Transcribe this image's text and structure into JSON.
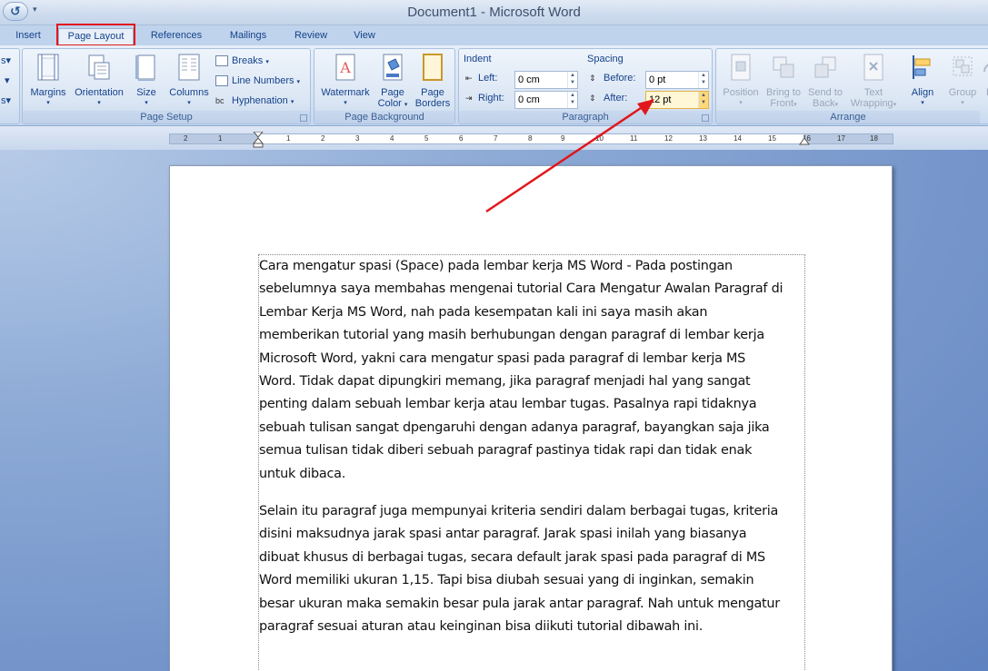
{
  "window": {
    "title": "Document1 - Microsoft Word"
  },
  "tabs": [
    {
      "label": "Insert"
    },
    {
      "label": "Page Layout"
    },
    {
      "label": "References"
    },
    {
      "label": "Mailings"
    },
    {
      "label": "Review"
    },
    {
      "label": "View"
    }
  ],
  "ribbon": {
    "page_setup": {
      "label": "Page Setup",
      "margins": "Margins",
      "orientation": "Orientation",
      "size": "Size",
      "columns": "Columns",
      "breaks": "Breaks",
      "line_numbers": "Line Numbers",
      "hyphenation": "Hyphenation"
    },
    "page_background": {
      "label": "Page Background",
      "watermark": "Watermark",
      "page_color_1": "Page",
      "page_color_2": "Color",
      "page_borders_1": "Page",
      "page_borders_2": "Borders"
    },
    "paragraph": {
      "label": "Paragraph",
      "indent_heading": "Indent",
      "left_label": "Left:",
      "left_value": "0 cm",
      "right_label": "Right:",
      "right_value": "0 cm",
      "spacing_heading": "Spacing",
      "before_label": "Before:",
      "before_value": "0 pt",
      "after_label": "After:",
      "after_value": "12 pt"
    },
    "arrange": {
      "label": "Arrange",
      "position": "Position",
      "bring_to_front_1": "Bring to",
      "bring_to_front_2": "Front",
      "send_to_back_1": "Send to",
      "send_to_back_2": "Back",
      "text_wrapping_1": "Text",
      "text_wrapping_2": "Wrapping",
      "align": "Align",
      "group": "Group",
      "rotate": "R"
    }
  },
  "ruler": {
    "ticks": [
      "2",
      "1",
      "1",
      "2",
      "3",
      "4",
      "5",
      "6",
      "7",
      "8",
      "9",
      "10",
      "11",
      "12",
      "13",
      "14",
      "15",
      "16",
      "17",
      "18"
    ]
  },
  "document": {
    "paragraphs": [
      [
        "Cara mengatur spasi (Space) pada lembar kerja MS Word - Pada postingan",
        "sebelumnya saya membahas mengenai tutorial Cara Mengatur Awalan Paragraf di",
        "Lembar Kerja MS Word, nah pada kesempatan kali ini saya masih akan",
        "memberikan tutorial yang masih berhubungan dengan paragraf di lembar kerja",
        "Microsoft Word, yakni  cara mengatur spasi pada paragraf di lembar kerja MS",
        "Word. Tidak dapat dipungkiri  memang, jika paragraf menjadi hal yang sangat",
        "penting dalam sebuah lembar kerja atau lembar tugas. Pasalnya rapi tidaknya",
        "sebuah tulisan sangat dpengaruhi dengan adanya paragraf, bayangkan saja jika",
        "semua tulisan tidak diberi sebuah paragraf pastinya tidak rapi dan tidak enak",
        "untuk dibaca."
      ],
      [
        "Selain itu paragraf juga mempunyai kriteria sendiri dalam berbagai tugas, kriteria",
        "disini maksudnya jarak spasi antar paragraf. Jarak spasi inilah yang biasanya",
        "dibuat khusus di berbagai tugas, secara default jarak spasi pada paragraf di MS",
        "Word memiliki ukuran 1,15. Tapi bisa diubah sesuai yang di inginkan, semakin",
        "besar ukuran maka semakin besar pula jarak antar paragraf. Nah untuk mengatur",
        "paragraf sesuai aturan atau keinginan bisa diikuti tutorial dibawah ini."
      ]
    ]
  },
  "colors": {
    "highlight_box": "#e1171c",
    "annotation_arrow": "#e1171c",
    "ribbon_text": "#15428b"
  }
}
